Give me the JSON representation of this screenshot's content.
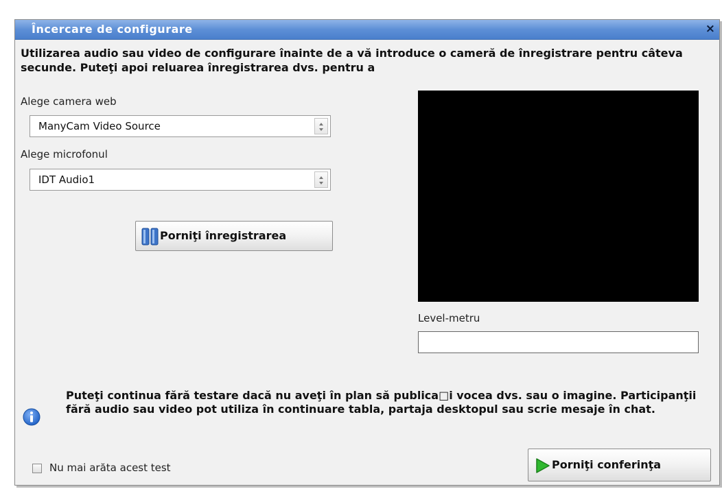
{
  "dialog": {
    "title": "Încercare de configurare",
    "close_label": "×",
    "intro": "Utilizarea audio sau video de configurare înainte de a vă introduce o cameră de înregistrare pentru câteva secunde. Puteţi apoi reluarea înregistrarea dvs. pentru a"
  },
  "camera": {
    "label": "Alege camera web",
    "value": "ManyCam Video Source"
  },
  "microphone": {
    "label": "Alege microfonul",
    "value": "IDT Audio1"
  },
  "record_button": {
    "label": "Porniţi înregistrarea",
    "icon": "pause-icon"
  },
  "level_meter": {
    "label": "Level-metru"
  },
  "info": {
    "icon": "info-icon",
    "text": "Puteţi continua fără testare dacă nu aveţi în plan să publica□i vocea dvs. sau o imagine. Participanţii fără audio sau video pot utiliza în continuare tabla, partaja desktopul sau scrie mesaje în chat."
  },
  "footer": {
    "checkbox_label": "Nu mai arăta acest test",
    "checkbox_checked": false,
    "start_conference_label": "Porniţi conferinţa",
    "start_icon": "play-arrow-icon"
  },
  "colors": {
    "title_bar": "#5d8fd6",
    "video_bg": "#000000",
    "play_arrow": "#2fb82f",
    "pause_blue": "#3e74c8"
  }
}
